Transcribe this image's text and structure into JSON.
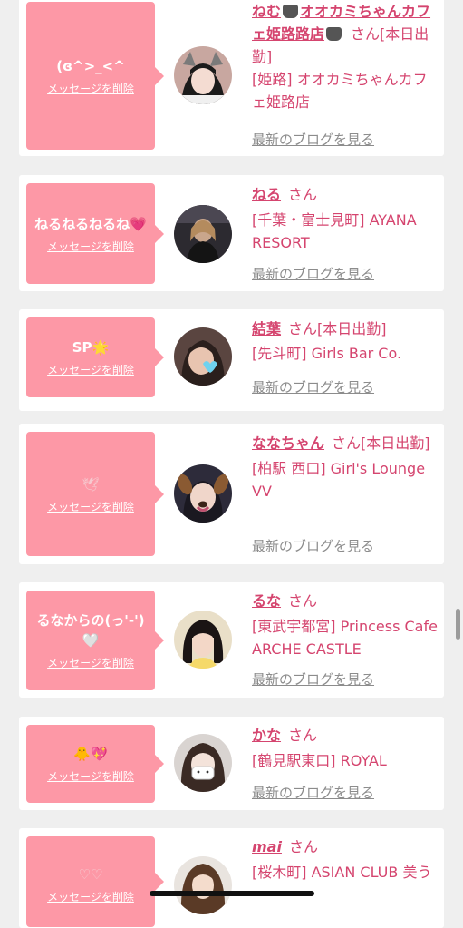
{
  "common": {
    "delete_label": "メッセージを削除",
    "san_label": "さん",
    "blog_label": "最新のブログを見る",
    "accent_color": "#d5456f",
    "bubble_color": "#fd98a6"
  },
  "cards": [
    {
      "message": "(ɞ^>_<^",
      "name": "ねむ",
      "name_suffix": "オオカミちゃんカフェ姫路路店",
      "status": "[本日出勤]",
      "shop": "[姫路] オオカミちゃんカフェ姫路店",
      "avatar_icon": "wolf-ears-avatar"
    },
    {
      "message": "ねるねるねるね💗",
      "name": "ねる",
      "status": "",
      "shop": "[千葉・富士見町] AYANA RESORT",
      "avatar_icon": "dark-room-avatar"
    },
    {
      "message": "SP🌟",
      "name": "結葉",
      "status": "[本日出勤]",
      "shop": "[先斗町] Girls Bar Co.",
      "avatar_icon": "heart-sticker-avatar"
    },
    {
      "message": "🕊",
      "name": "ななちゃん",
      "status": "[本日出勤]",
      "shop": "[柏駅 西口] Girl's Lounge VV",
      "avatar_icon": "dog-filter-avatar"
    },
    {
      "message": "るなからの(っ'-')🤍",
      "name": "るな",
      "status": "",
      "shop": "[東武宇都宮] Princess Cafe ARCHE CASTLE",
      "avatar_icon": "bob-hair-avatar"
    },
    {
      "message": "🐥💖",
      "name": "かな",
      "status": "",
      "shop": "[鶴見駅東口] ROYAL",
      "avatar_icon": "face-mask-avatar"
    },
    {
      "message": "♡♡",
      "name": "mai",
      "status": "",
      "shop": "[桜木町] ASIAN CLUB 美う",
      "avatar_icon": "long-hair-avatar"
    }
  ]
}
